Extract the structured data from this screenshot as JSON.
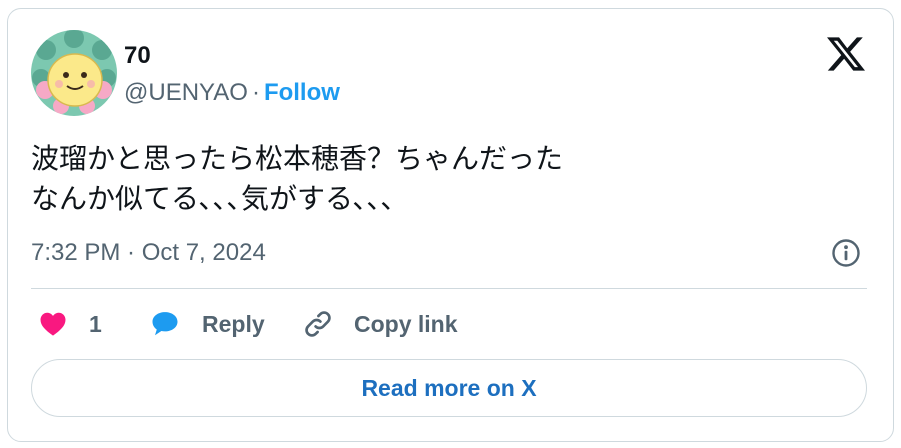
{
  "author": {
    "display_name": "70",
    "handle": "@UENYAO",
    "separator": "·",
    "follow_label": "Follow",
    "avatar_icon": "cartoon-face-avatar"
  },
  "brand": {
    "logo_icon": "x-logo",
    "color": "#0f1419"
  },
  "tweet": {
    "text": "波瑠かと思ったら松本穂香？ちゃんだった\nなんか似てる､､､気がする､､､",
    "timestamp": "7:32 PM · Oct 7, 2024"
  },
  "actions": {
    "like_icon": "heart-icon",
    "like_count": "1",
    "like_color": "#f91880",
    "reply_icon": "speech-bubble-icon",
    "reply_label": "Reply",
    "reply_color": "#1d9bf0",
    "copy_icon": "link-icon",
    "copy_label": "Copy link"
  },
  "footer": {
    "read_more_label": "Read more on X"
  },
  "colors": {
    "accent": "#1d9bf0",
    "text": "#0f1419",
    "muted": "#536471",
    "border": "#cfd9de"
  }
}
